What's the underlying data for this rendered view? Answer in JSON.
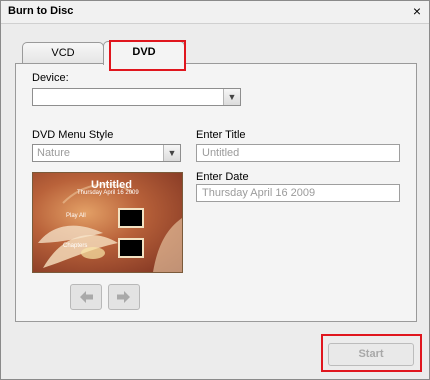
{
  "window": {
    "title": "Burn to Disc",
    "close_glyph": "×"
  },
  "tabs": [
    {
      "label": "VCD"
    },
    {
      "label": "DVD",
      "selected": true
    }
  ],
  "device": {
    "label": "Device:",
    "value": ""
  },
  "menu_style": {
    "label": "DVD Menu Style",
    "value": "Nature"
  },
  "title_field": {
    "label": "Enter Title",
    "value": "Untitled"
  },
  "date_field": {
    "label": "Enter Date",
    "value": "Thursday  April 16  2009"
  },
  "preview": {
    "title": "Untitled",
    "date": "Thursday  April 16  2009",
    "play_all": "Play All",
    "chapters": "Chapters"
  },
  "icons": {
    "dropdown": "chevron-down-icon",
    "prev": "arrow-left-icon",
    "next": "arrow-right-icon",
    "close": "close-icon"
  },
  "colors": {
    "highlight": "#e0161e"
  },
  "actions": {
    "start_label": "Start"
  }
}
